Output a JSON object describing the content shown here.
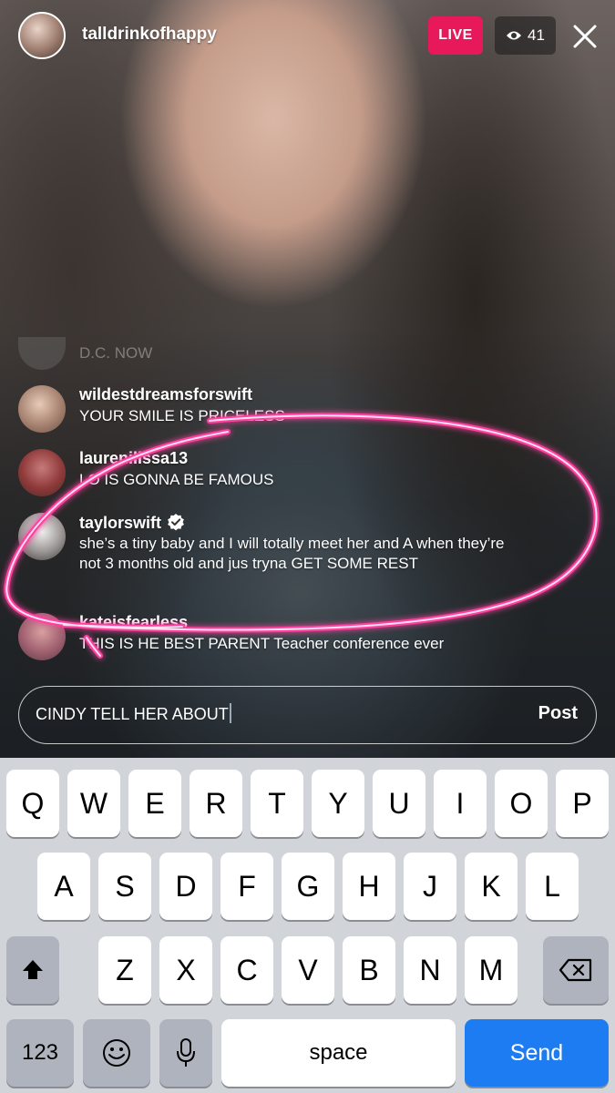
{
  "header": {
    "host_username": "talldrinkofhappy",
    "live_label": "LIVE",
    "viewer_count": "41"
  },
  "comments": {
    "faded_text": "D.C. NOW",
    "items": [
      {
        "username": "wildestdreamsforswift",
        "text": "YOUR SMILE IS PRICELESS"
      },
      {
        "username": "laurenilissa13",
        "text": "LO IS GONNA BE FAMOUS"
      },
      {
        "username": "taylorswift",
        "verified": true,
        "text": "she’s a tiny baby and I will totally meet her and A when they’re not 3 months old and jus tryna GET SOME REST"
      },
      {
        "username": "kateisfearless",
        "text": "THIS IS HE BEST PARENT Teacher conference ever"
      }
    ]
  },
  "composer": {
    "input_value": "CINDY TELL HER ABOUT",
    "post_label": "Post"
  },
  "keyboard": {
    "row1": [
      "Q",
      "W",
      "E",
      "R",
      "T",
      "Y",
      "U",
      "I",
      "O",
      "P"
    ],
    "row2": [
      "A",
      "S",
      "D",
      "F",
      "G",
      "H",
      "J",
      "K",
      "L"
    ],
    "row3": [
      "Z",
      "X",
      "C",
      "V",
      "B",
      "N",
      "M"
    ],
    "numbers_label": "123",
    "space_label": "space",
    "send_label": "Send",
    "icons": [
      "shift-icon",
      "backspace-icon",
      "emoji-icon",
      "microphone-icon"
    ]
  },
  "colors": {
    "live_badge": "#e8195a",
    "send_key": "#1e7cf2",
    "annotation_stroke": "#ff3fa0"
  }
}
